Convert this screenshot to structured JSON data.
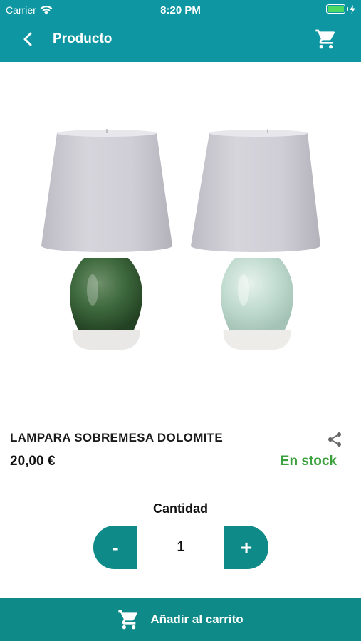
{
  "status_bar": {
    "carrier": "Carrier",
    "time": "8:20 PM",
    "battery_level": 1.0
  },
  "nav": {
    "back_icon": "chevron-left-icon",
    "title": "Producto",
    "cart_icon": "cart-icon"
  },
  "product": {
    "image_description_icon": "product-photo",
    "name": "LAMPARA SOBREMESA DOLOMITE",
    "price": "20,00 €",
    "stock": "En stock",
    "share_icon": "share-icon"
  },
  "quantity": {
    "label": "Cantidad",
    "minus_label": "-",
    "value": "1",
    "plus_label": "+"
  },
  "footer": {
    "add_to_cart_label": "Añadir al carrito",
    "cart_icon": "cart-icon"
  },
  "colors": {
    "header": "#0e97a2",
    "button": "#0e8a88",
    "stock": "#3aa13c"
  }
}
